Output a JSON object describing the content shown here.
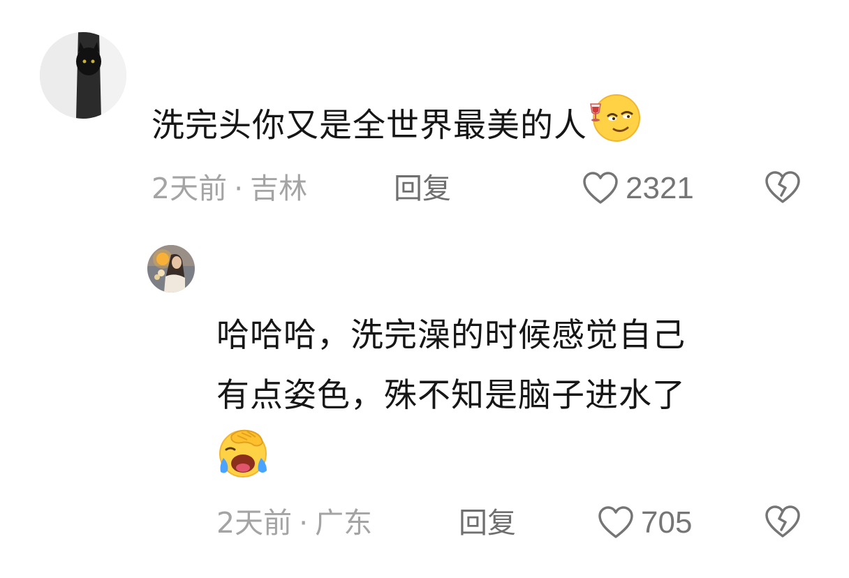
{
  "comments": [
    {
      "text": "洗完头你又是全世界最美的人",
      "emoji": "smug-toast-emoji",
      "time": "2天前",
      "location": "吉林",
      "reply_label": "回复",
      "likes": "2321",
      "avatar": "black-cat-avatar"
    },
    {
      "text_line1": "哈哈哈，洗完澡的时候感觉自己",
      "text_line2": "有点姿色，殊不知是脑子进水了",
      "emoji": "facepalm-crying-emoji",
      "time": "2天前",
      "location": "广东",
      "reply_label": "回复",
      "likes": "705",
      "avatar": "sunset-girl-avatar"
    }
  ],
  "meta_separator": "·",
  "icons": {
    "like": "heart-outline-icon",
    "dislike": "broken-heart-icon"
  },
  "colors": {
    "text": "#161616",
    "meta": "#a4a4a4",
    "reply": "#6f6f6f"
  }
}
